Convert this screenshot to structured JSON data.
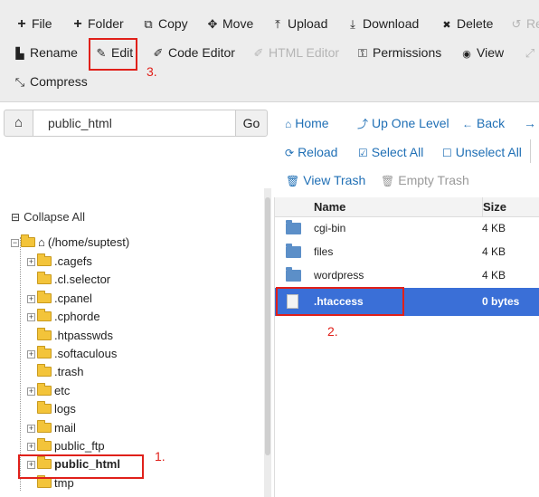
{
  "toolbar": {
    "row1": [
      {
        "icon": "plus-icon",
        "glyph": "+",
        "label": "File"
      },
      {
        "icon": "plus-icon",
        "glyph": "+",
        "label": "Folder"
      },
      {
        "icon": "copy-icon",
        "glyph": "⧉",
        "label": "Copy"
      },
      {
        "icon": "move-icon",
        "glyph": "✥",
        "label": "Move"
      },
      {
        "icon": "upload-icon",
        "glyph": "⤒",
        "label": "Upload"
      },
      {
        "icon": "download-icon",
        "glyph": "⤓",
        "label": "Download"
      },
      {
        "icon": "close-icon",
        "glyph": "✖",
        "label": "Delete"
      },
      {
        "icon": "restore-icon",
        "glyph": "↺",
        "label": "Re"
      }
    ],
    "row2": [
      {
        "icon": "file-icon",
        "glyph": "▙",
        "label": "Rename"
      },
      {
        "icon": "pencil-icon",
        "glyph": "✎",
        "label": "Edit"
      },
      {
        "icon": "code-edit-icon",
        "glyph": "✐",
        "label": "Code Editor"
      },
      {
        "icon": "html-edit-icon",
        "glyph": "✐",
        "label": "HTML Editor"
      },
      {
        "icon": "key-icon",
        "glyph": "⚿",
        "label": "Permissions"
      },
      {
        "icon": "eye-icon",
        "glyph": "◉",
        "label": "View"
      },
      {
        "icon": "expand-icon",
        "glyph": "⤢",
        "label": ""
      }
    ],
    "row3": [
      {
        "icon": "compress-icon",
        "glyph": "⤡",
        "label": "Compress"
      }
    ]
  },
  "callouts": {
    "one": "1.",
    "two": "2.",
    "three": "3."
  },
  "pathbar": {
    "home_glyph": "⌂",
    "path_value": "public_html",
    "go_label": "Go"
  },
  "nav": {
    "home": "Home",
    "up_one_level": "Up One Level",
    "back": "Back",
    "forward_glyph": "→",
    "reload": "Reload",
    "select_all": "Select All",
    "unselect_all": "Unselect All",
    "view_trash": "View Trash",
    "empty_trash": "Empty Trash"
  },
  "tree": {
    "collapse_label": "Collapse All",
    "root_label": "(/home/suptest)",
    "items": [
      {
        "label": ".cagefs",
        "expandable": true
      },
      {
        "label": ".cl.selector",
        "expandable": false
      },
      {
        "label": ".cpanel",
        "expandable": true
      },
      {
        "label": ".cphorde",
        "expandable": true
      },
      {
        "label": ".htpasswds",
        "expandable": false
      },
      {
        "label": ".softaculous",
        "expandable": true
      },
      {
        "label": ".trash",
        "expandable": false
      },
      {
        "label": "etc",
        "expandable": true
      },
      {
        "label": "logs",
        "expandable": false
      },
      {
        "label": "mail",
        "expandable": true
      },
      {
        "label": "public_ftp",
        "expandable": true
      },
      {
        "label": "public_html",
        "expandable": true
      },
      {
        "label": "tmp",
        "expandable": false
      }
    ]
  },
  "table": {
    "headers": {
      "name": "Name",
      "size": "Size"
    },
    "rows": [
      {
        "name": "cgi-bin",
        "size": "4 KB",
        "type": "folder"
      },
      {
        "name": "files",
        "size": "4 KB",
        "type": "folder"
      },
      {
        "name": "wordpress",
        "size": "4 KB",
        "type": "folder"
      },
      {
        "name": ".htaccess",
        "size": "0 bytes",
        "type": "file"
      }
    ]
  },
  "colors": {
    "accent": "#1f6fb5",
    "selection": "#3a6fd7",
    "highlight": "#e0201a",
    "folder": "#f3c43a"
  }
}
